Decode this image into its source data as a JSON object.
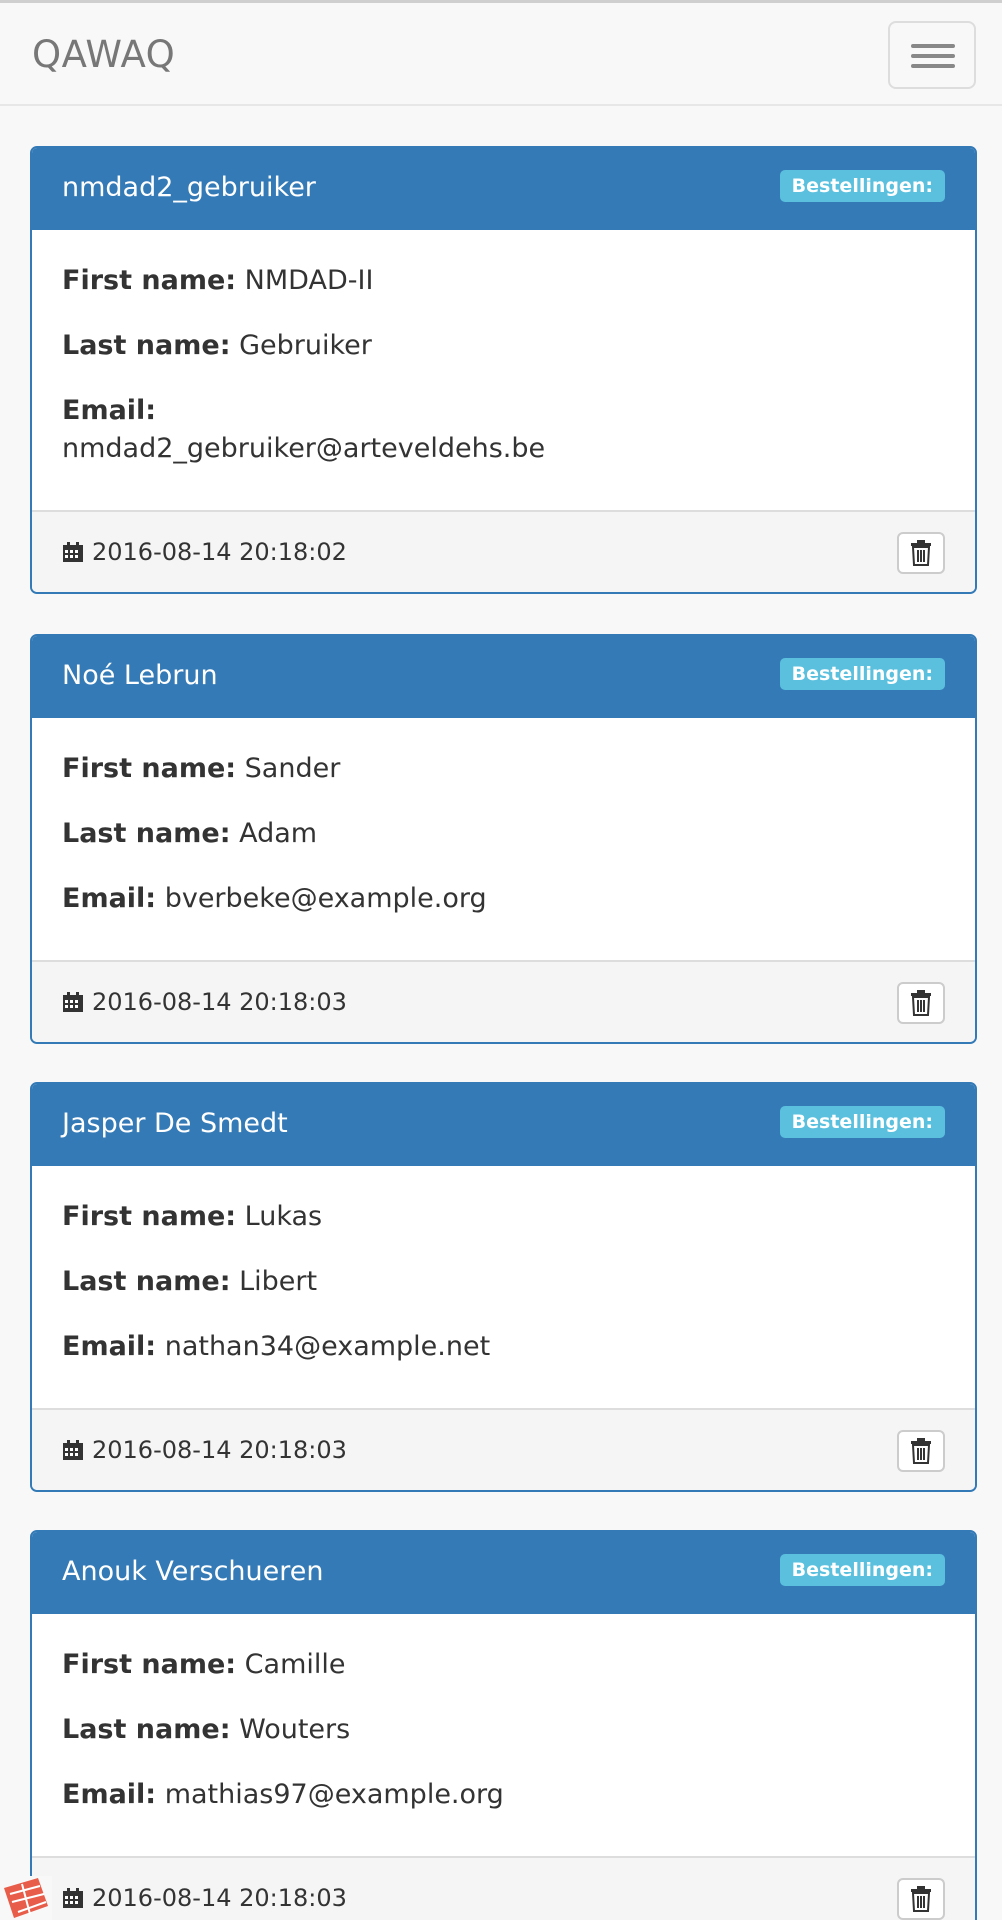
{
  "navbar": {
    "brand": "QAWAQ",
    "menu_icon": "hamburger-menu-icon"
  },
  "labels": {
    "first_name": "First name:",
    "last_name": "Last name:",
    "email": "Email:",
    "orders_badge": "Bestellingen:"
  },
  "users": [
    {
      "username": "nmdad2_gebruiker",
      "first_name": "NMDAD-II",
      "last_name": "Gebruiker",
      "email": "nmdad2_gebruiker@arteveldehs.be",
      "created": "2016-08-14 20:18:02"
    },
    {
      "username": "Noé Lebrun",
      "first_name": "Sander",
      "last_name": "Adam",
      "email": "bverbeke@example.org",
      "created": "2016-08-14 20:18:03"
    },
    {
      "username": "Jasper De Smedt",
      "first_name": "Lukas",
      "last_name": "Libert",
      "email": "nathan34@example.net",
      "created": "2016-08-14 20:18:03"
    },
    {
      "username": "Anouk Verschueren",
      "first_name": "Camille",
      "last_name": "Wouters",
      "email": "mathias97@example.org",
      "created": "2016-08-14 20:18:03"
    }
  ],
  "icons": {
    "calendar": "calendar-icon",
    "delete": "trash-icon"
  },
  "colors": {
    "primary": "#337ab7",
    "badge": "#5bc0de",
    "navbar_bg": "#f8f8f8"
  }
}
